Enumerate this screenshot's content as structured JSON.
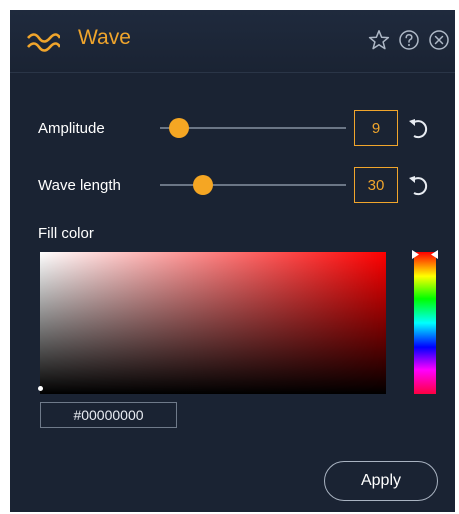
{
  "header": {
    "title": "Wave",
    "icon": "wave-icon",
    "buttons": [
      "star-icon",
      "help-icon",
      "close-icon"
    ],
    "accent_color": "#f0a52c"
  },
  "amplitude": {
    "label": "Amplitude",
    "value": "9",
    "slider_level_fraction": 0.1
  },
  "wave_length": {
    "label": "Wave length",
    "value": "30",
    "slider_level_fraction": 0.23
  },
  "fill_color": {
    "label": "Fill color",
    "hex_value": "#00000000",
    "hue": "#ff0000"
  },
  "apply_button": {
    "label": "Apply"
  },
  "colors": {
    "panel_background": "#1a2333",
    "slider_thumb": "#f5a623",
    "text": "#ffffff"
  }
}
